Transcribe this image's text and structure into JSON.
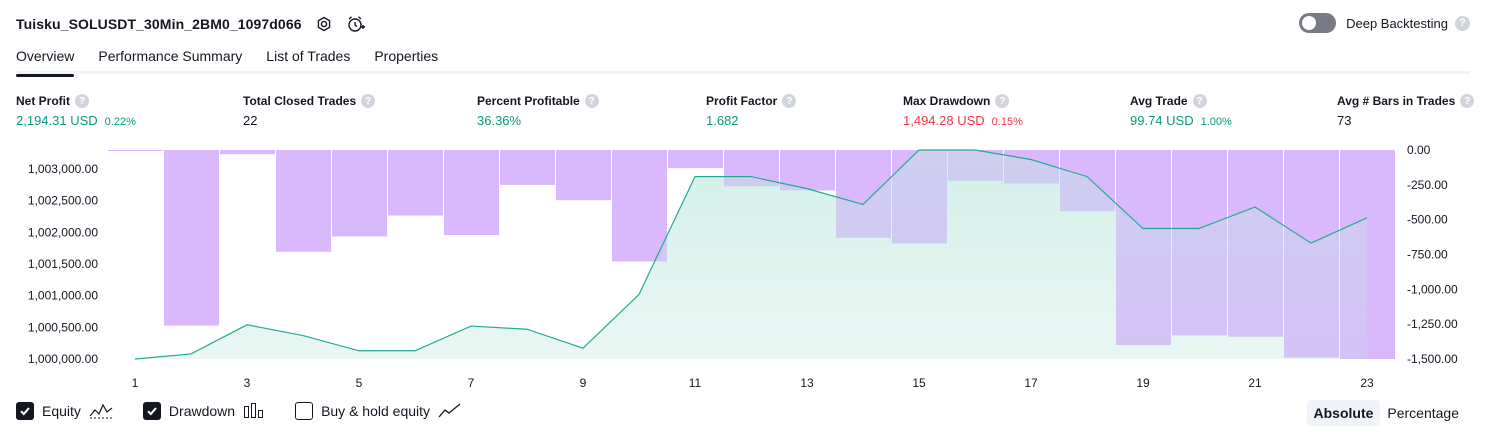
{
  "header": {
    "title": "Tuisku_SOLUSDT_30Min_2BM0_1097d066",
    "deep_backtesting_label": "Deep Backtesting"
  },
  "tabs": [
    {
      "label": "Overview",
      "active": true
    },
    {
      "label": "Performance Summary",
      "active": false
    },
    {
      "label": "List of Trades",
      "active": false
    },
    {
      "label": "Properties",
      "active": false
    }
  ],
  "metrics": [
    {
      "label": "Net Profit",
      "value": "2,194.31 USD",
      "percent": "0.22%",
      "color": "#089981"
    },
    {
      "label": "Total Closed Trades",
      "value": "22",
      "percent": "",
      "color": "#131722"
    },
    {
      "label": "Percent Profitable",
      "value": "36.36%",
      "percent": "",
      "color": "#089981"
    },
    {
      "label": "Profit Factor",
      "value": "1.682",
      "percent": "",
      "color": "#089981"
    },
    {
      "label": "Max Drawdown",
      "value": "1,494.28 USD",
      "percent": "0.15%",
      "color": "#f23645"
    },
    {
      "label": "Avg Trade",
      "value": "99.74 USD",
      "percent": "1.00%",
      "color": "#089981"
    },
    {
      "label": "Avg # Bars in Trades",
      "value": "73",
      "percent": "",
      "color": "#131722"
    }
  ],
  "legend": {
    "equity_label": "Equity",
    "drawdown_label": "Drawdown",
    "buyhold_label": "Buy & hold equity",
    "equity_checked": true,
    "drawdown_checked": true,
    "buyhold_checked": false
  },
  "view_switch": {
    "absolute_label": "Absolute",
    "percentage_label": "Percentage",
    "active": "Absolute"
  },
  "colors": {
    "equity_line": "#22ab94",
    "equity_fill": "#c8ebe2",
    "drawdown_bar": "#d1a8fb",
    "positive": "#089981",
    "negative": "#f23645"
  },
  "chart_data": {
    "type": "line",
    "x_tick_labels": [
      "1",
      "3",
      "5",
      "7",
      "9",
      "11",
      "13",
      "15",
      "17",
      "19",
      "21",
      "23"
    ],
    "left_axis_labels": [
      "1,000,000.00",
      "1,000,500.00",
      "1,001,000.00",
      "1,001,500.00",
      "1,002,000.00",
      "1,002,500.00",
      "1,003,000.00"
    ],
    "right_axis_labels": [
      "0.00",
      "-250.00",
      "-500.00",
      "-750.00",
      "-1,000.00",
      "-1,250.00",
      "-1,500.00"
    ],
    "ylim_left": [
      1000000,
      1003300
    ],
    "ylim_right": [
      -1500,
      0
    ],
    "xlim": [
      0,
      23
    ],
    "series": [
      {
        "name": "Equity",
        "x": [
          1,
          2,
          3,
          4,
          5,
          6,
          7,
          8,
          9,
          10,
          11,
          12,
          13,
          14,
          15,
          16,
          17,
          18,
          19,
          20,
          21,
          22,
          23
        ],
        "values": [
          1000000,
          1000080,
          1000540,
          1000370,
          1000130,
          1000130,
          1000520,
          1000470,
          1000170,
          1001020,
          1002880,
          1002880,
          1002690,
          1002440,
          1003300,
          1003300,
          1003150,
          1002880,
          1002060,
          1002060,
          1002400,
          1001830,
          1002230
        ]
      },
      {
        "name": "Drawdown",
        "x": [
          1,
          2,
          3,
          4,
          5,
          6,
          7,
          8,
          9,
          10,
          11,
          12,
          13,
          14,
          15,
          16,
          17,
          18,
          19,
          20,
          21,
          22,
          23
        ],
        "values": [
          0,
          -1260,
          -30,
          -730,
          -620,
          -470,
          -610,
          -250,
          -360,
          -800,
          -130,
          -260,
          -290,
          -630,
          -670,
          -220,
          -240,
          -440,
          -1400,
          -1330,
          -1340,
          -1490,
          -1500
        ]
      }
    ]
  }
}
